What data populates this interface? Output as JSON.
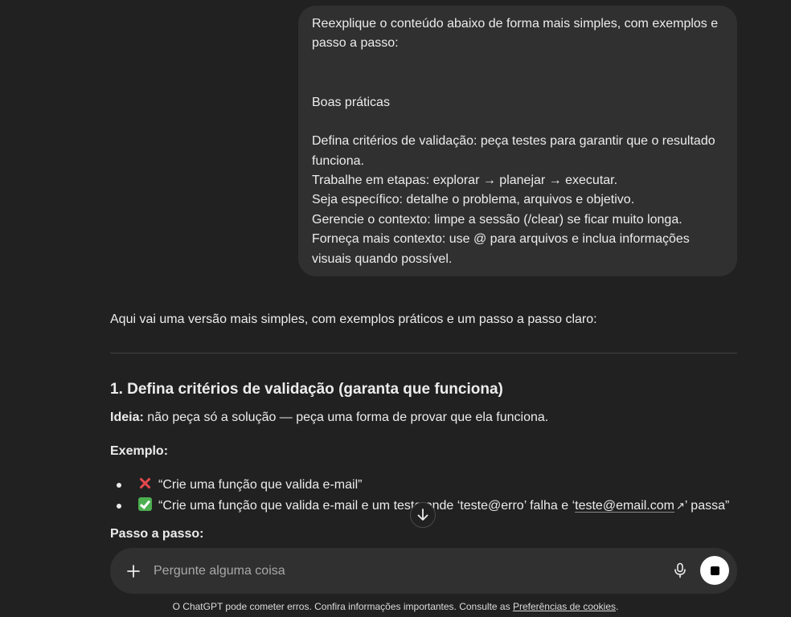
{
  "user_message": {
    "line1": "Reexplique o conteúdo abaixo de forma mais simples, com exemplos e passo a passo:",
    "heading": "Boas práticas",
    "items": [
      "Defina critérios de validação: peça testes para garantir que o resultado funciona.",
      "Trabalhe em etapas: explorar → planejar → executar.",
      "Seja específico: detalhe o problema, arquivos e objetivo.",
      "Gerencie o contexto: limpe a sessão (/clear) se ficar muito longa.",
      "Forneça mais contexto: use @ para arquivos e inclua informações visuais quando possível."
    ]
  },
  "assistant": {
    "intro": "Aqui vai uma versão mais simples, com exemplos práticos e um passo a passo claro:",
    "section_title": "1. Defina critérios de validação (garanta que funciona)",
    "idea_label": "Ideia:",
    "idea_text": " não peça só a solução — peça uma forma de provar que ela funciona.",
    "example_label": "Exemplo:",
    "bullet_bad": "“Crie uma função que valida e-mail”",
    "bullet_good_prefix": "“Crie uma função que valida e-mail e um teste onde ‘teste@erro’ falha e ‘",
    "bullet_good_link": "teste@email.com",
    "bullet_good_suffix": "’ passa”",
    "steps_label": "Passo a passo:"
  },
  "composer": {
    "placeholder": "Pergunte alguma coisa"
  },
  "footer": {
    "text": "O ChatGPT pode cometer erros. Confira informações importantes. Consulte as ",
    "link": "Preferências de cookies",
    "end": "."
  },
  "icons": {
    "add": "plus-icon",
    "mic": "microphone-icon",
    "stop": "stop-icon",
    "scroll": "arrow-down-icon",
    "bad": "cross-mark-icon",
    "good": "check-mark-icon"
  }
}
